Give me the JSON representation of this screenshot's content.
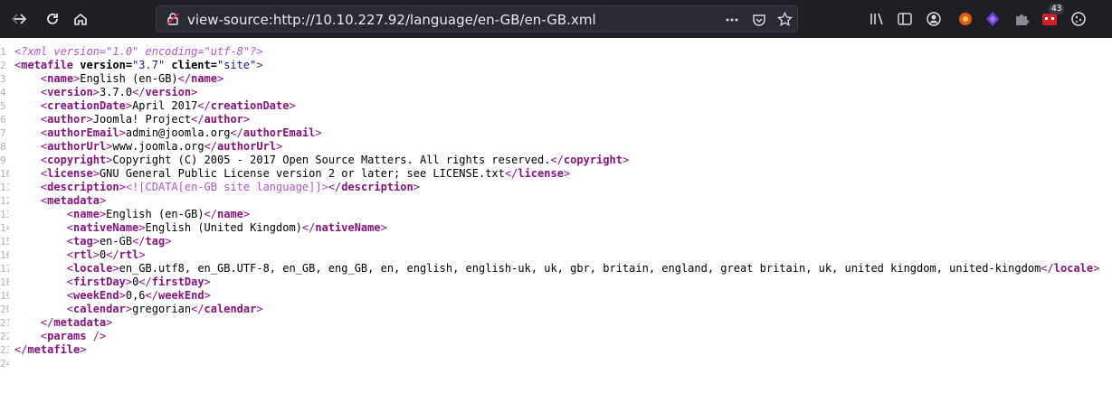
{
  "browser": {
    "url": "view-source:http://10.10.227.92/language/en-GB/en-GB.xml",
    "extension_badge": "43",
    "colors": {
      "toolbar": "#1f1e25",
      "urlbar": "#2b2a33",
      "tag": "#881280",
      "attr_value": "#1a1aa6",
      "pi": "#b054d0"
    }
  },
  "source": {
    "line_numbers": [
      "1",
      "2",
      "3",
      "4",
      "5",
      "6",
      "7",
      "8",
      "9",
      "10",
      "11",
      "12",
      "13",
      "14",
      "15",
      "16",
      "17",
      "18",
      "19",
      "20",
      "21",
      "22",
      "23",
      "24"
    ],
    "l1": {
      "pi": "<?xml version=\"1.0\" encoding=\"utf-8\"?>"
    },
    "l2": {
      "open": "<",
      "tag": "metafile",
      "attr1": " version=",
      "val1": "\"3.7\"",
      "attr2": " client=",
      "val2": "\"site\"",
      "close": ">"
    },
    "l3": {
      "indent": "    ",
      "tag": "name",
      "text": "English (en-GB)"
    },
    "l4": {
      "indent": "    ",
      "tag": "version",
      "text": "3.7.0"
    },
    "l5": {
      "indent": "    ",
      "tag": "creationDate",
      "text": "April 2017"
    },
    "l6": {
      "indent": "    ",
      "tag": "author",
      "text": "Joomla! Project"
    },
    "l7": {
      "indent": "    ",
      "tag": "authorEmail",
      "text": "admin@joomla.org"
    },
    "l8": {
      "indent": "    ",
      "tag": "authorUrl",
      "text": "www.joomla.org"
    },
    "l9": {
      "indent": "    ",
      "tag": "copyright",
      "text": "Copyright (C) 2005 - 2017 Open Source Matters. All rights reserved."
    },
    "l10": {
      "indent": "    ",
      "tag": "license",
      "text": "GNU General Public License version 2 or later; see LICENSE.txt"
    },
    "l11": {
      "indent": "    ",
      "tag": "description",
      "cdata": "<![CDATA[en-GB site language]]>"
    },
    "l12": {
      "indent": "    ",
      "tag": "metadata"
    },
    "l13": {
      "indent": "        ",
      "tag": "name",
      "text": "English (en-GB)"
    },
    "l14": {
      "indent": "        ",
      "tag": "nativeName",
      "text": "English (United Kingdom)"
    },
    "l15": {
      "indent": "        ",
      "tag": "tag",
      "text": "en-GB"
    },
    "l16": {
      "indent": "        ",
      "tag": "rtl",
      "text": "0"
    },
    "l17": {
      "indent": "        ",
      "tag": "locale",
      "text": "en_GB.utf8, en_GB.UTF-8, en_GB, eng_GB, en, english, english-uk, uk, gbr, britain, england, great britain, uk, united kingdom, united-kingdom"
    },
    "l18": {
      "indent": "        ",
      "tag": "firstDay",
      "text": "0"
    },
    "l19": {
      "indent": "        ",
      "tag": "weekEnd",
      "text": "0,6"
    },
    "l20": {
      "indent": "        ",
      "tag": "calendar",
      "text": "gregorian"
    },
    "l21": {
      "indent": "    ",
      "tag": "metadata"
    },
    "l22": {
      "indent": "    ",
      "tag": "params",
      "selfclose": " />"
    },
    "l23": {
      "tag": "metafile"
    }
  }
}
